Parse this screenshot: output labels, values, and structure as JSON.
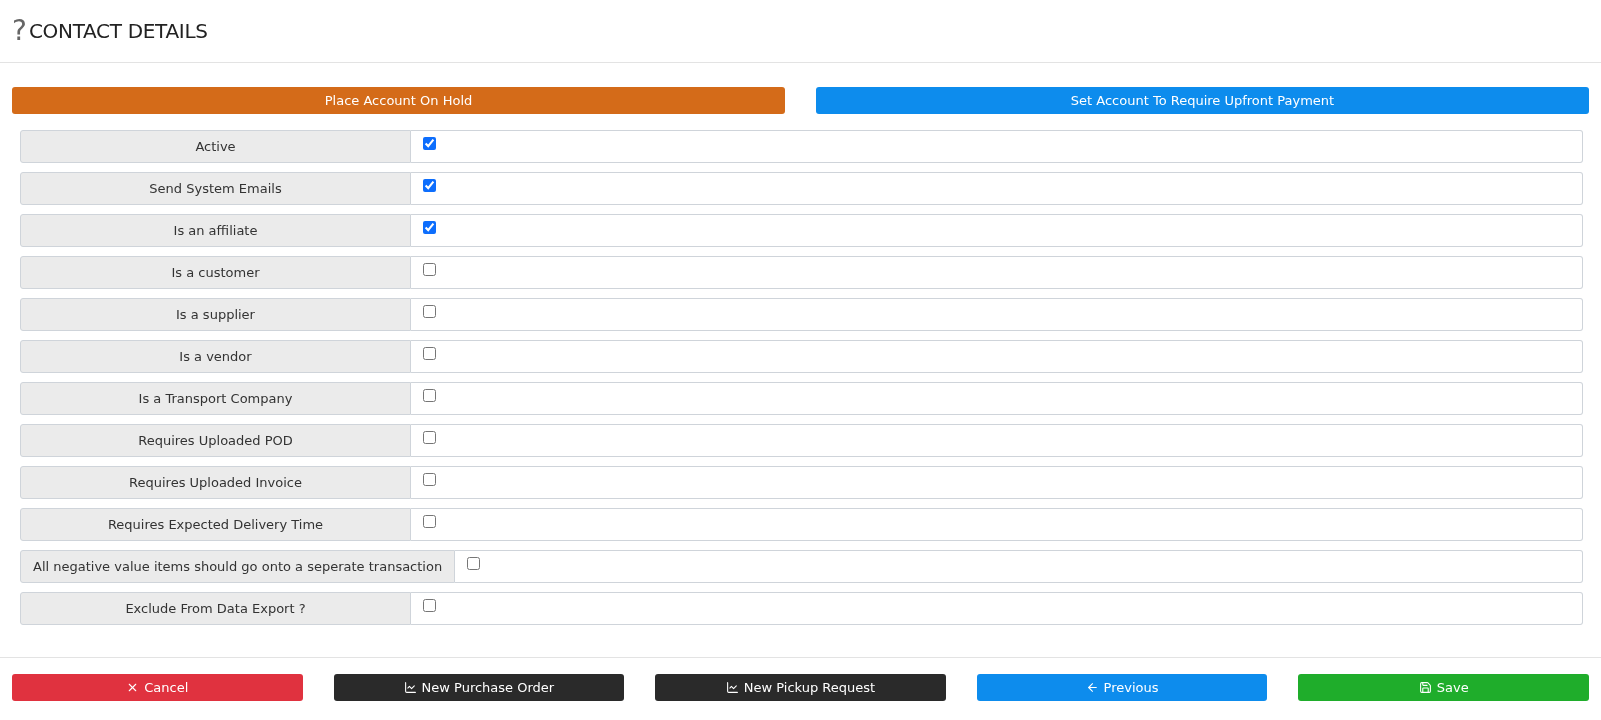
{
  "header": {
    "icon_glyph": "?",
    "title": "CONTACT DETAILS"
  },
  "action_buttons": [
    {
      "label": "Place Account On Hold",
      "kind": "warning"
    },
    {
      "label": "Set Account To Require Upfront Payment",
      "kind": "primary"
    }
  ],
  "fields": [
    {
      "label": "Active",
      "checked": true
    },
    {
      "label": "Send System Emails",
      "checked": true
    },
    {
      "label": "Is an affiliate",
      "checked": true
    },
    {
      "label": "Is a customer",
      "checked": false
    },
    {
      "label": "Is a supplier",
      "checked": false
    },
    {
      "label": "Is a vendor",
      "checked": false
    },
    {
      "label": "Is a Transport Company",
      "checked": false
    },
    {
      "label": "Requires Uploaded POD",
      "checked": false
    },
    {
      "label": "Requires Uploaded Invoice",
      "checked": false
    },
    {
      "label": "Requires Expected Delivery Time",
      "checked": false
    },
    {
      "label": "All negative value items should go onto a seperate transaction",
      "checked": false
    },
    {
      "label": "Exclude From Data Export ?",
      "checked": false
    }
  ],
  "footer_buttons": [
    {
      "label": "Cancel",
      "kind": "cancel"
    },
    {
      "label": "New Purchase Order",
      "kind": "create"
    },
    {
      "label": "New Pickup Request",
      "kind": "create"
    },
    {
      "label": "Previous",
      "kind": "back"
    },
    {
      "label": "Save",
      "kind": "save"
    }
  ]
}
